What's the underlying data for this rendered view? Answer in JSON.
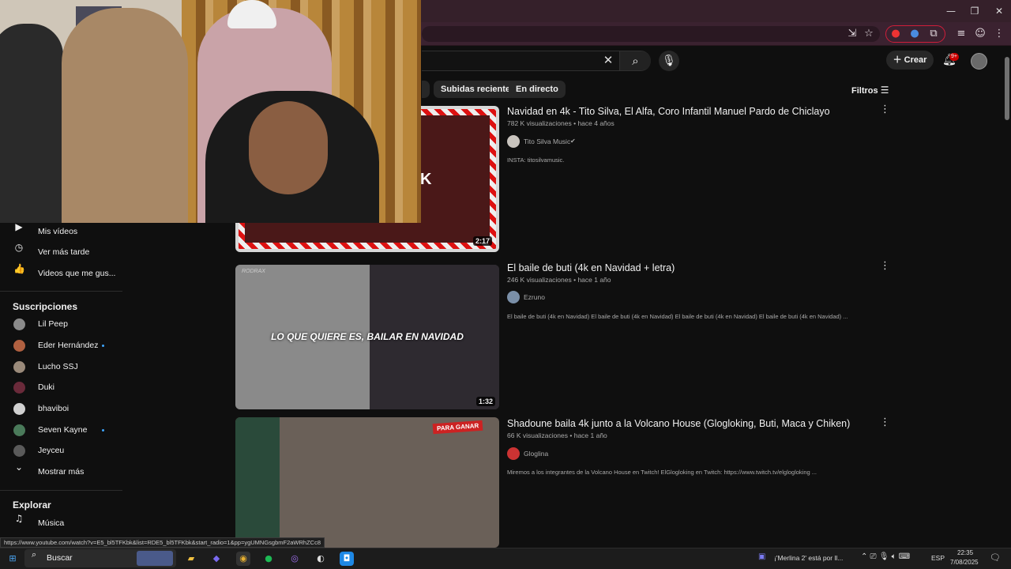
{
  "chrome": {
    "min": "—",
    "restore": "❐",
    "close": "✕"
  },
  "search": {
    "clear_icon": "✕",
    "search_icon": "⌕",
    "mic_icon": "🎙"
  },
  "header": {
    "create_label": "Crear",
    "notif_badge": "9+"
  },
  "chips": [
    "Subidas recientes",
    "En directo"
  ],
  "filters_label": "Filtros",
  "sidebar": {
    "you_items": [
      {
        "label": "Mis vídeos",
        "icon": "▶"
      },
      {
        "label": "Ver más tarde",
        "icon": "◷"
      },
      {
        "label": "Videos que me gus...",
        "icon": "👍"
      }
    ],
    "subs_title": "Suscripciones",
    "subscriptions": [
      {
        "name": "Lil Peep",
        "color": "#8a8a8a",
        "dot": false
      },
      {
        "name": "Eder Hernández",
        "color": "#b06040",
        "dot": true
      },
      {
        "name": "Lucho SSJ",
        "color": "#9a8a7a",
        "dot": false
      },
      {
        "name": "Duki",
        "color": "#6a2a3a",
        "dot": false
      },
      {
        "name": "bhaviboi",
        "color": "#d0d0d0",
        "dot": false
      },
      {
        "name": "Seven Kayne",
        "color": "#4a7a5a",
        "dot": true
      },
      {
        "name": "Jeyceu",
        "color": "#5a5a5a",
        "dot": false
      }
    ],
    "show_more": "Mostrar más",
    "explore_title": "Explorar",
    "explore_items": [
      {
        "label": "Música",
        "icon": "♫"
      }
    ]
  },
  "videos": [
    {
      "title": "Navidad en 4k - Tito Silva, El Alfa, Coro Infantil Manuel Pardo de Chiclayo",
      "meta": "782 K visualizaciones • hace 4 años",
      "channel": "Tito Silva Music",
      "verified": true,
      "desc": "INSTA: titosilvamusic.",
      "duration": "2:17",
      "thumb_text": "K"
    },
    {
      "title": "El baile de buti (4k en Navidad + letra)",
      "meta": "246 K visualizaciones • hace 1 año",
      "channel": "Ezruno",
      "verified": false,
      "desc": "El baile de buti (4k en Navidad) El baile de buti (4k en Navidad) El baile de buti (4k en Navidad) El baile de buti (4k en Navidad) ...",
      "duration": "1:32",
      "thumb_text": "LO QUE QUIERE ES, BAILAR EN NAVIDAD",
      "thumb_tag": "RODRAX"
    },
    {
      "title": "Shadoune baila 4k junto a la Volcano House (Glogloking, Buti, Maca y Chiken)",
      "meta": "66 K visualizaciones • hace 1 año",
      "channel": "Gloglina",
      "verified": false,
      "desc": "Miremos a los integrantes de la Volcano House en Twitch! ElGlogloking en Twitch: https://www.twitch.tv/elglogloking ...",
      "duration": "",
      "thumb_text": "PARA GANAR"
    }
  ],
  "status_url": "https://www.youtube.com/watch?v=E5_bl5TFKbk&list=RDE5_bl5TFKbk&start_radio=1&pp=ygUMNGsgbmF2aWRhZCc8",
  "taskbar": {
    "search_placeholder": "Buscar",
    "notification": "¡'Merlina 2' está por ll...",
    "lang": "ESP",
    "time": "22:35",
    "date": "7/08/2025"
  },
  "colors": {
    "accent_blue": "#3ea6ff",
    "notif_red": "#cc0000"
  }
}
